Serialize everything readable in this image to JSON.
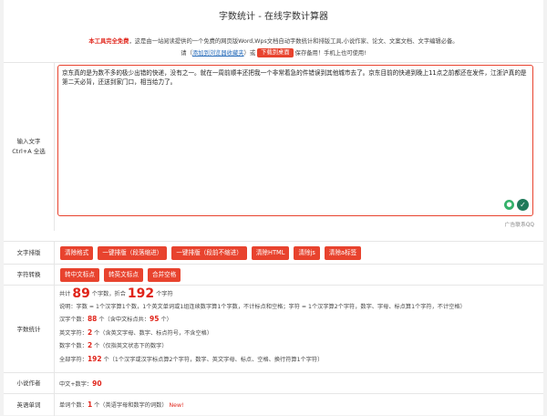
{
  "page_title": "字数统计 - 在线字数计算器",
  "intro": {
    "free_badge": "本工具完全免费",
    "desc": "，这是由一站阅读提供的一个免费的网页版Word,Wps文档自动字数统计和排版工具,小说作家、论文、文案文档、文字编辑必备。",
    "line2_prefix": "请（",
    "bookmark_link": "添加到浏览器收藏夹",
    "line2_mid": "）或",
    "download_button": "下载到桌面",
    "line2_suffix": "保存备用！手机上也可使用!"
  },
  "input": {
    "label": "输入文字",
    "hint": "Ctrl+A 全选",
    "text": "京东真的是为数不多的极少出错的快递，没有之一。就在一周前顺丰还把我一个非常着急的件错误到其他城市去了。京东目前的快递到晚上11点之前都还在发件，江浙沪真的是第二天必背，还送到家门口，相当给力了。",
    "ad_text": "广告联系QQ"
  },
  "format_row": {
    "label": "文字排版",
    "buttons": [
      "清除格式",
      "一键排版（段落缩进）",
      "一键排版（段前不缩进）",
      "清除HTML",
      "清除js",
      "清除a标签"
    ]
  },
  "convert_row": {
    "label": "字符转换",
    "buttons": [
      "转中文标点",
      "转英文标点",
      "合并空格"
    ]
  },
  "stats": {
    "label": "字数统计",
    "total_prefix": "共计",
    "word_count": "89",
    "words_unit": "个字数，折合",
    "char_count": "192",
    "chars_unit": "个字符",
    "explain": "说明：字数 = 1个汉字算1个数，1个英文单词或1组连续数字算1个字数，不计标点和空格；字符 = 1个汉字算2个字符，数字、字母、标点算1个字符，不计空格）",
    "hanzi_label": "汉字个数：",
    "hanzi_count": "88",
    "hanzi_note": "个（含中文标点共：",
    "hanzi_punct": "95",
    "hanzi_note_end": "个）",
    "eng_label": "英文字符：",
    "eng_count": "2",
    "eng_note": "个（含英文字母、数字、标点符号，不含空格）",
    "digit_label": "数字个数：",
    "digit_count": "2",
    "digit_note": "个（仅指英文状态下的数字）",
    "all_label": "全部字符：",
    "all_count": "192",
    "all_note": "个（1个汉字或汉字标点算2个字符，数字、英文字母、标点、空格、换行符算1个字符）"
  },
  "novel": {
    "label": "小说作者",
    "text": "中文+数字：",
    "count": "90"
  },
  "english": {
    "label": "英语单词",
    "text": "单词个数：",
    "count": "1",
    "note": "个（英语字母和数字的词数）",
    "new_badge": "New!"
  },
  "colors": {
    "accent": "#e8432e",
    "highlight_red": "#e0241a",
    "link": "#2a6ebb"
  }
}
